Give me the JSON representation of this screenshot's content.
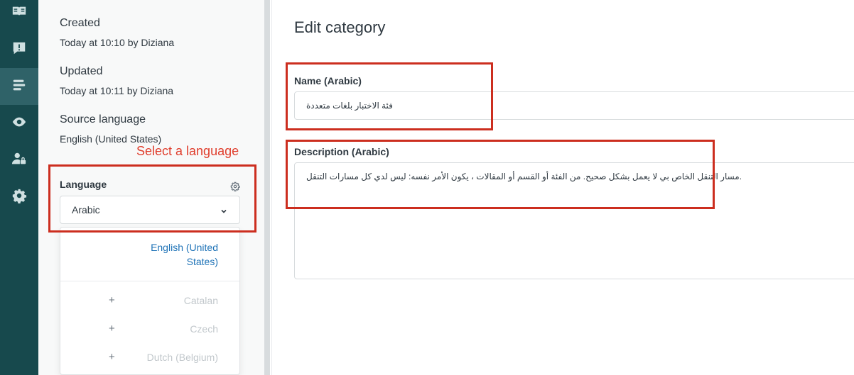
{
  "rail": {
    "items": [
      {
        "icon": "book-icon"
      },
      {
        "icon": "alert-comment-icon"
      },
      {
        "icon": "list-arrange-icon",
        "active": true
      },
      {
        "icon": "eye-icon"
      },
      {
        "icon": "user-lock-icon"
      },
      {
        "icon": "gear-icon"
      }
    ]
  },
  "sidebar": {
    "created_label": "Created",
    "created_value": "Today at 10:10 by Diziana",
    "updated_label": "Updated",
    "updated_value": "Today at 10:11 by Diziana",
    "source_label": "Source language",
    "source_value": "English (United States)",
    "annotation": "Select a language",
    "language_label": "Language",
    "language_selected": "Arabic",
    "dropdown": {
      "current": "English (United States)",
      "options": [
        {
          "plus": "+",
          "name": "Catalan"
        },
        {
          "plus": "+",
          "name": "Czech"
        },
        {
          "plus": "+",
          "name": "Dutch (Belgium)"
        }
      ]
    }
  },
  "main": {
    "title": "Edit category",
    "name_label": "Name (Arabic)",
    "name_value": "فئة الاختبار بلغات متعددة",
    "description_label": "Description (Arabic)",
    "description_value": ".مسار التنقل الخاص بي لا يعمل بشكل صحيح. من الفئة أو القسم أو المقالات ، يكون الأمر نفسه: ليس لدي كل مسارات التنقل"
  },
  "colors": {
    "rail": "#17494d",
    "rail_active": "#2f6268",
    "annotation": "#e03e2d",
    "link": "#1f73b7"
  }
}
